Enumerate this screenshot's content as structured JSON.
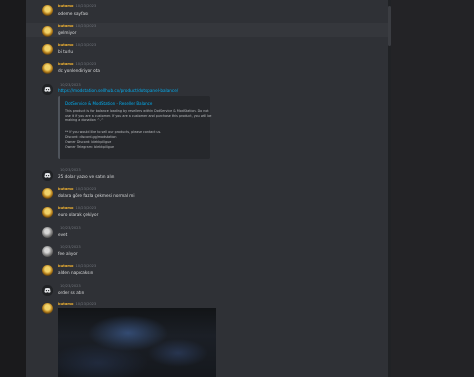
{
  "messages": [
    {
      "user": "butamo",
      "time": "10/23/2023",
      "text": "odeme sayfası",
      "avatar": "gold-avatar"
    },
    {
      "user": "butamo",
      "time": "10/23/2023",
      "text": "gelmiyor",
      "avatar": "gold-avatar",
      "highlighted": true
    },
    {
      "user": "butamo",
      "time": "10/23/2023",
      "text": "bi turlu",
      "avatar": "gold-avatar"
    },
    {
      "user": "butamo",
      "time": "10/23/2023",
      "text": "dc yonlendiriyor ota",
      "avatar": "gold-avatar"
    },
    {
      "user": "",
      "time": "10/23/2023",
      "text": "https://modstation.sellhub.cx/product/dotspanel-balance/",
      "avatar": "discord-avatar"
    },
    {
      "user": "",
      "time": "10/23/2023",
      "text": "25 dolar yazıo ve satın alın",
      "avatar": "discord-avatar"
    },
    {
      "user": "butamo",
      "time": "10/23/2023",
      "text": "dolara göre fazla çekmesi normal mi",
      "avatar": "gold-avatar"
    },
    {
      "user": "butamo",
      "time": "10/23/2023",
      "text": "euro olarak çekiyor",
      "avatar": "gold-avatar"
    },
    {
      "user": "",
      "time": "10/23/2023",
      "text": "evet",
      "avatar": "gray-avatar"
    },
    {
      "user": "",
      "time": "10/23/2023",
      "text": "fee alıyor",
      "avatar": "gray-avatar"
    },
    {
      "user": "butamo",
      "time": "10/23/2023",
      "text": "alden napıcaksın",
      "avatar": "gold-avatar"
    },
    {
      "user": "",
      "time": "10/23/2023",
      "text": "order ss atın",
      "avatar": "discord-avatar"
    },
    {
      "user": "butamo",
      "time": "10/23/2023",
      "text": "",
      "avatar": "gold-avatar"
    }
  ],
  "embed": {
    "title": "DotService & ModStation - Reseller Balance",
    "lines": [
      "This product is for balance loading by resellers within DotService & ModStation. Do not",
      "use it if you are a customer. If you are a customer and purchase this product, you will be",
      "making a donation ^-^",
      "",
      "** If you would like to sell our products, please contact us.",
      "Discord: discord.gg/modstation",
      "Owner Discord: blekkpiligue",
      "Owner Telegram: blekkpiligue"
    ]
  },
  "colors": {
    "background": "#2f3136",
    "username": "#f0b232",
    "link": "#00b0f4",
    "text": "#dcddde"
  }
}
